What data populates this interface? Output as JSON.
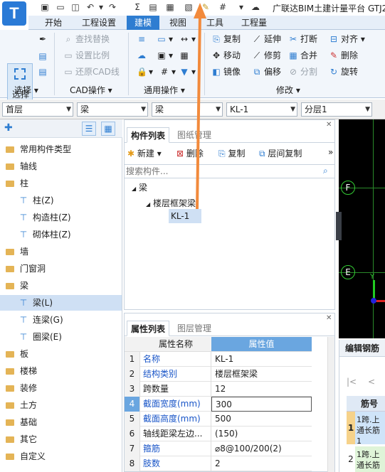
{
  "app": {
    "logo_letter": "T",
    "title": "广联达BIM土建计量平台 GTJ2"
  },
  "tabs": [
    "开始",
    "工程设置",
    "建模",
    "视图",
    "工具",
    "工程量"
  ],
  "ribbon": {
    "select_label": "选择",
    "groups": [
      "选择",
      "CAD操作",
      "通用操作",
      "修改"
    ],
    "cad": [
      "查找替换",
      "设置比例",
      "还原CAD线"
    ],
    "modify": [
      "复制",
      "延伸",
      "打断",
      "对齐",
      "移动",
      "修剪",
      "合并",
      "删除",
      "镜像",
      "偏移",
      "分割",
      "旋转"
    ]
  },
  "combos": [
    "首层",
    "梁",
    "梁",
    "KL-1",
    "分层1"
  ],
  "left_tree": [
    {
      "label": "常用构件类型",
      "level": 0
    },
    {
      "label": "轴线",
      "level": 0
    },
    {
      "label": "柱",
      "level": 0
    },
    {
      "label": "柱(Z)",
      "level": 1
    },
    {
      "label": "构造柱(Z)",
      "level": 1
    },
    {
      "label": "砌体柱(Z)",
      "level": 1
    },
    {
      "label": "墙",
      "level": 0
    },
    {
      "label": "门窗洞",
      "level": 0
    },
    {
      "label": "梁",
      "level": 0
    },
    {
      "label": "梁(L)",
      "level": 1,
      "selected": true
    },
    {
      "label": "连梁(G)",
      "level": 1
    },
    {
      "label": "圈梁(E)",
      "level": 1
    },
    {
      "label": "板",
      "level": 0
    },
    {
      "label": "楼梯",
      "level": 0
    },
    {
      "label": "装修",
      "level": 0
    },
    {
      "label": "土方",
      "level": 0
    },
    {
      "label": "基础",
      "level": 0
    },
    {
      "label": "其它",
      "level": 0
    },
    {
      "label": "自定义",
      "level": 0
    }
  ],
  "component_panel": {
    "tabs": [
      "构件列表",
      "图纸管理"
    ],
    "toolbar": [
      "新建",
      "删除",
      "复制",
      "层间复制"
    ],
    "search_placeholder": "搜索构件...",
    "tree": [
      "梁",
      "楼层框架梁",
      "KL-1"
    ]
  },
  "property_panel": {
    "tabs": [
      "属性列表",
      "图层管理"
    ],
    "col_name": "属性名称",
    "col_value": "属性值",
    "rows": [
      {
        "n": "1",
        "k": "名称",
        "v": "KL-1",
        "blue": true
      },
      {
        "n": "2",
        "k": "结构类别",
        "v": "楼层框架梁",
        "blue": true
      },
      {
        "n": "3",
        "k": "跨数量",
        "v": "12",
        "blue": false
      },
      {
        "n": "4",
        "k": "截面宽度(mm)",
        "v": "300",
        "blue": true
      },
      {
        "n": "5",
        "k": "截面高度(mm)",
        "v": "500",
        "blue": true
      },
      {
        "n": "6",
        "k": "轴线距梁左边...",
        "v": "(150)",
        "blue": false
      },
      {
        "n": "7",
        "k": "箍筋",
        "v": "⌀8@100/200(2)",
        "blue": true
      },
      {
        "n": "8",
        "k": "肢数",
        "v": "2",
        "blue": true
      }
    ]
  },
  "canvas": {
    "axis_f": "F",
    "axis_e": "E",
    "y_label": "Y"
  },
  "rebar_panel": {
    "title": "编辑钢筋",
    "header": "筋号",
    "row1": "1跨.上通长筋1",
    "row2": "1跨.上通长筋2",
    "n1": "1",
    "n2": "2"
  }
}
